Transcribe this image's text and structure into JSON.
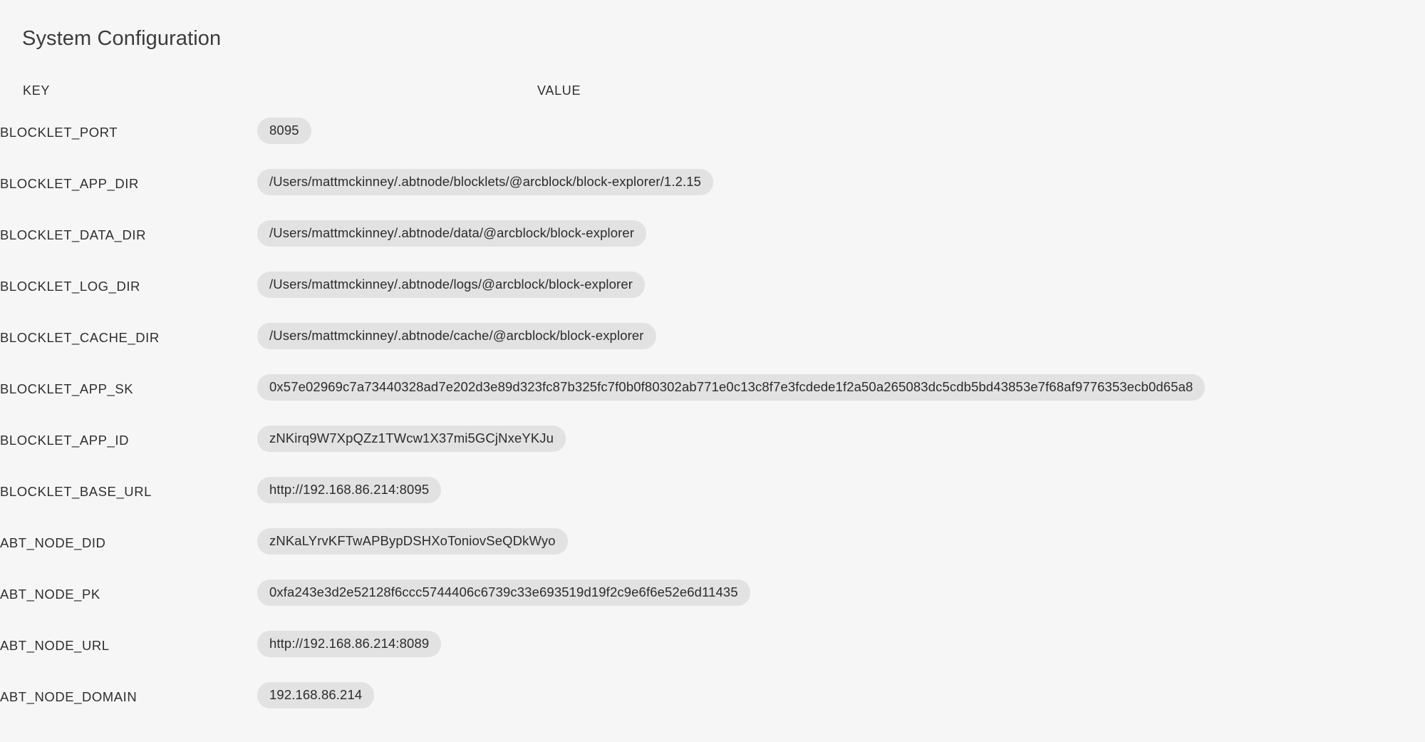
{
  "page": {
    "title": "System Configuration"
  },
  "table": {
    "columns": [
      {
        "id": "key",
        "header": "KEY"
      },
      {
        "id": "value",
        "header": "VALUE"
      }
    ],
    "rows": [
      {
        "key": "BLOCKLET_PORT",
        "value": "8095"
      },
      {
        "key": "BLOCKLET_APP_DIR",
        "value": "/Users/mattmckinney/.abtnode/blocklets/@arcblock/block-explorer/1.2.15"
      },
      {
        "key": "BLOCKLET_DATA_DIR",
        "value": "/Users/mattmckinney/.abtnode/data/@arcblock/block-explorer"
      },
      {
        "key": "BLOCKLET_LOG_DIR",
        "value": "/Users/mattmckinney/.abtnode/logs/@arcblock/block-explorer"
      },
      {
        "key": "BLOCKLET_CACHE_DIR",
        "value": "/Users/mattmckinney/.abtnode/cache/@arcblock/block-explorer"
      },
      {
        "key": "BLOCKLET_APP_SK",
        "value": "0x57e02969c7a73440328ad7e202d3e89d323fc87b325fc7f0b0f80302ab771e0c13c8f7e3fcdede1f2a50a265083dc5cdb5bd43853e7f68af9776353ecb0d65a8"
      },
      {
        "key": "BLOCKLET_APP_ID",
        "value": "zNKirq9W7XpQZz1TWcw1X37mi5GCjNxeYKJu"
      },
      {
        "key": "BLOCKLET_BASE_URL",
        "value": "http://192.168.86.214:8095"
      },
      {
        "key": "ABT_NODE_DID",
        "value": "zNKaLYrvKFTwAPBypDSHXoToniovSeQDkWyo"
      },
      {
        "key": "ABT_NODE_PK",
        "value": "0xfa243e3d2e52128f6ccc5744406c6739c33e693519d19f2c9e6f6e52e6d11435"
      },
      {
        "key": "ABT_NODE_URL",
        "value": "http://192.168.86.214:8089"
      },
      {
        "key": "ABT_NODE_DOMAIN",
        "value": "192.168.86.214"
      }
    ]
  },
  "colors": {
    "page_background": "#f6f6f6",
    "chip_background": "#e2e2e2",
    "text_primary": "#2f2f2f",
    "title_text": "#3c3c3c"
  }
}
